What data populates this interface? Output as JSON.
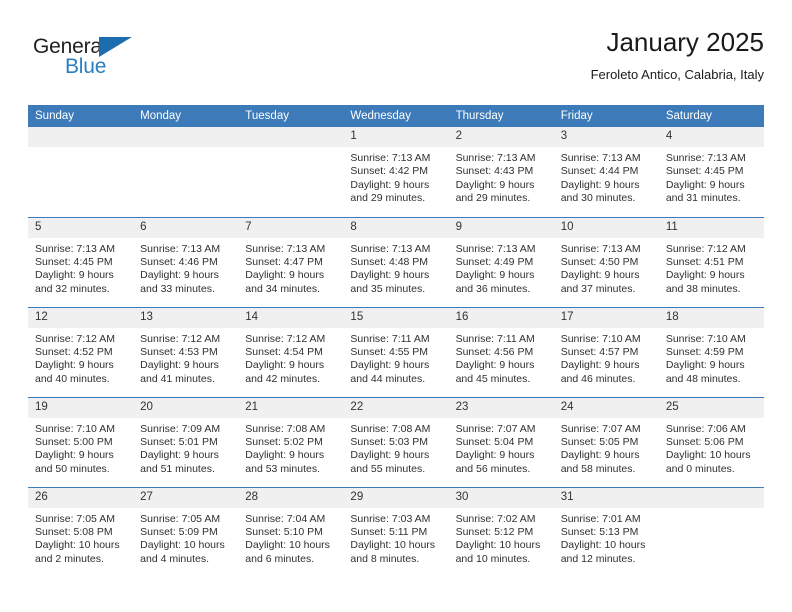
{
  "brand": {
    "name_primary": "General",
    "name_secondary": "Blue",
    "triangle_icon": "triangle-icon",
    "accent_color": "#2a7fc1",
    "triangle_color": "#1c6cb0"
  },
  "header": {
    "title": "January 2025",
    "subtitle": "Feroleto Antico, Calabria, Italy"
  },
  "theme": {
    "header_blue": "#3c7ab9",
    "daynum_bg": "#f0f0f0",
    "grid_line": "#3c7ab9",
    "text_color": "#303030"
  },
  "columns": [
    "Sunday",
    "Monday",
    "Tuesday",
    "Wednesday",
    "Thursday",
    "Friday",
    "Saturday"
  ],
  "labels": {
    "sunrise_prefix": "Sunrise:",
    "sunset_prefix": "Sunset:",
    "daylight_prefix": "Daylight:"
  },
  "weeks": [
    [
      {
        "day": "",
        "empty": true
      },
      {
        "day": "",
        "empty": true
      },
      {
        "day": "",
        "empty": true
      },
      {
        "day": "1",
        "sunrise": "Sunrise: 7:13 AM",
        "sunset": "Sunset: 4:42 PM",
        "daylight_line1": "Daylight: 9 hours",
        "daylight_line2": "and 29 minutes."
      },
      {
        "day": "2",
        "sunrise": "Sunrise: 7:13 AM",
        "sunset": "Sunset: 4:43 PM",
        "daylight_line1": "Daylight: 9 hours",
        "daylight_line2": "and 29 minutes."
      },
      {
        "day": "3",
        "sunrise": "Sunrise: 7:13 AM",
        "sunset": "Sunset: 4:44 PM",
        "daylight_line1": "Daylight: 9 hours",
        "daylight_line2": "and 30 minutes."
      },
      {
        "day": "4",
        "sunrise": "Sunrise: 7:13 AM",
        "sunset": "Sunset: 4:45 PM",
        "daylight_line1": "Daylight: 9 hours",
        "daylight_line2": "and 31 minutes."
      }
    ],
    [
      {
        "day": "5",
        "sunrise": "Sunrise: 7:13 AM",
        "sunset": "Sunset: 4:45 PM",
        "daylight_line1": "Daylight: 9 hours",
        "daylight_line2": "and 32 minutes."
      },
      {
        "day": "6",
        "sunrise": "Sunrise: 7:13 AM",
        "sunset": "Sunset: 4:46 PM",
        "daylight_line1": "Daylight: 9 hours",
        "daylight_line2": "and 33 minutes."
      },
      {
        "day": "7",
        "sunrise": "Sunrise: 7:13 AM",
        "sunset": "Sunset: 4:47 PM",
        "daylight_line1": "Daylight: 9 hours",
        "daylight_line2": "and 34 minutes."
      },
      {
        "day": "8",
        "sunrise": "Sunrise: 7:13 AM",
        "sunset": "Sunset: 4:48 PM",
        "daylight_line1": "Daylight: 9 hours",
        "daylight_line2": "and 35 minutes."
      },
      {
        "day": "9",
        "sunrise": "Sunrise: 7:13 AM",
        "sunset": "Sunset: 4:49 PM",
        "daylight_line1": "Daylight: 9 hours",
        "daylight_line2": "and 36 minutes."
      },
      {
        "day": "10",
        "sunrise": "Sunrise: 7:13 AM",
        "sunset": "Sunset: 4:50 PM",
        "daylight_line1": "Daylight: 9 hours",
        "daylight_line2": "and 37 minutes."
      },
      {
        "day": "11",
        "sunrise": "Sunrise: 7:12 AM",
        "sunset": "Sunset: 4:51 PM",
        "daylight_line1": "Daylight: 9 hours",
        "daylight_line2": "and 38 minutes."
      }
    ],
    [
      {
        "day": "12",
        "sunrise": "Sunrise: 7:12 AM",
        "sunset": "Sunset: 4:52 PM",
        "daylight_line1": "Daylight: 9 hours",
        "daylight_line2": "and 40 minutes."
      },
      {
        "day": "13",
        "sunrise": "Sunrise: 7:12 AM",
        "sunset": "Sunset: 4:53 PM",
        "daylight_line1": "Daylight: 9 hours",
        "daylight_line2": "and 41 minutes."
      },
      {
        "day": "14",
        "sunrise": "Sunrise: 7:12 AM",
        "sunset": "Sunset: 4:54 PM",
        "daylight_line1": "Daylight: 9 hours",
        "daylight_line2": "and 42 minutes."
      },
      {
        "day": "15",
        "sunrise": "Sunrise: 7:11 AM",
        "sunset": "Sunset: 4:55 PM",
        "daylight_line1": "Daylight: 9 hours",
        "daylight_line2": "and 44 minutes."
      },
      {
        "day": "16",
        "sunrise": "Sunrise: 7:11 AM",
        "sunset": "Sunset: 4:56 PM",
        "daylight_line1": "Daylight: 9 hours",
        "daylight_line2": "and 45 minutes."
      },
      {
        "day": "17",
        "sunrise": "Sunrise: 7:10 AM",
        "sunset": "Sunset: 4:57 PM",
        "daylight_line1": "Daylight: 9 hours",
        "daylight_line2": "and 46 minutes."
      },
      {
        "day": "18",
        "sunrise": "Sunrise: 7:10 AM",
        "sunset": "Sunset: 4:59 PM",
        "daylight_line1": "Daylight: 9 hours",
        "daylight_line2": "and 48 minutes."
      }
    ],
    [
      {
        "day": "19",
        "sunrise": "Sunrise: 7:10 AM",
        "sunset": "Sunset: 5:00 PM",
        "daylight_line1": "Daylight: 9 hours",
        "daylight_line2": "and 50 minutes."
      },
      {
        "day": "20",
        "sunrise": "Sunrise: 7:09 AM",
        "sunset": "Sunset: 5:01 PM",
        "daylight_line1": "Daylight: 9 hours",
        "daylight_line2": "and 51 minutes."
      },
      {
        "day": "21",
        "sunrise": "Sunrise: 7:08 AM",
        "sunset": "Sunset: 5:02 PM",
        "daylight_line1": "Daylight: 9 hours",
        "daylight_line2": "and 53 minutes."
      },
      {
        "day": "22",
        "sunrise": "Sunrise: 7:08 AM",
        "sunset": "Sunset: 5:03 PM",
        "daylight_line1": "Daylight: 9 hours",
        "daylight_line2": "and 55 minutes."
      },
      {
        "day": "23",
        "sunrise": "Sunrise: 7:07 AM",
        "sunset": "Sunset: 5:04 PM",
        "daylight_line1": "Daylight: 9 hours",
        "daylight_line2": "and 56 minutes."
      },
      {
        "day": "24",
        "sunrise": "Sunrise: 7:07 AM",
        "sunset": "Sunset: 5:05 PM",
        "daylight_line1": "Daylight: 9 hours",
        "daylight_line2": "and 58 minutes."
      },
      {
        "day": "25",
        "sunrise": "Sunrise: 7:06 AM",
        "sunset": "Sunset: 5:06 PM",
        "daylight_line1": "Daylight: 10 hours",
        "daylight_line2": "and 0 minutes."
      }
    ],
    [
      {
        "day": "26",
        "sunrise": "Sunrise: 7:05 AM",
        "sunset": "Sunset: 5:08 PM",
        "daylight_line1": "Daylight: 10 hours",
        "daylight_line2": "and 2 minutes."
      },
      {
        "day": "27",
        "sunrise": "Sunrise: 7:05 AM",
        "sunset": "Sunset: 5:09 PM",
        "daylight_line1": "Daylight: 10 hours",
        "daylight_line2": "and 4 minutes."
      },
      {
        "day": "28",
        "sunrise": "Sunrise: 7:04 AM",
        "sunset": "Sunset: 5:10 PM",
        "daylight_line1": "Daylight: 10 hours",
        "daylight_line2": "and 6 minutes."
      },
      {
        "day": "29",
        "sunrise": "Sunrise: 7:03 AM",
        "sunset": "Sunset: 5:11 PM",
        "daylight_line1": "Daylight: 10 hours",
        "daylight_line2": "and 8 minutes."
      },
      {
        "day": "30",
        "sunrise": "Sunrise: 7:02 AM",
        "sunset": "Sunset: 5:12 PM",
        "daylight_line1": "Daylight: 10 hours",
        "daylight_line2": "and 10 minutes."
      },
      {
        "day": "31",
        "sunrise": "Sunrise: 7:01 AM",
        "sunset": "Sunset: 5:13 PM",
        "daylight_line1": "Daylight: 10 hours",
        "daylight_line2": "and 12 minutes."
      },
      {
        "day": "",
        "empty": true
      }
    ]
  ]
}
